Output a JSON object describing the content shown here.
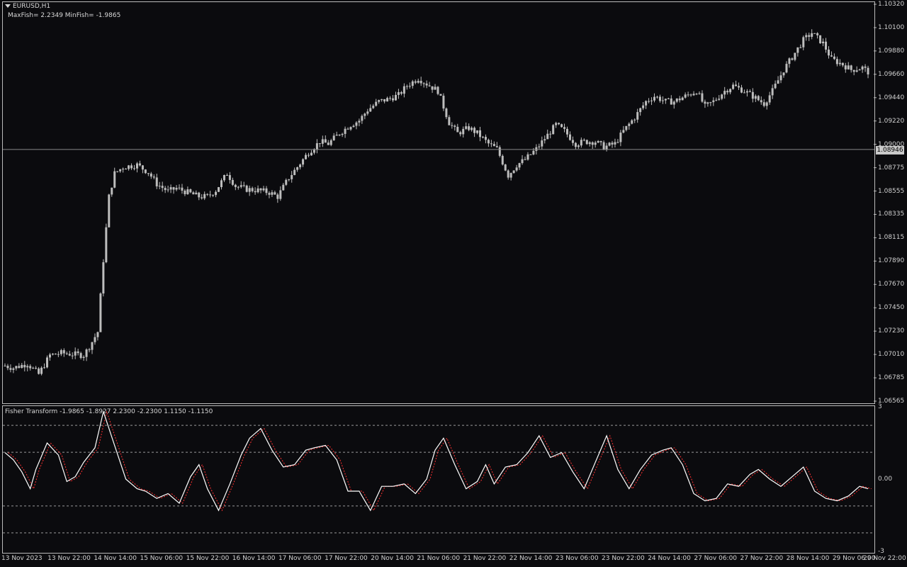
{
  "chart_header": {
    "symbol_label": "EURUSD,H1",
    "fisher_stats": "MaxFish= 2.2349 MinFish= -1.9865"
  },
  "indicator_header": {
    "label": "Fisher Transform -1.9865 -1.8927 2.2300 -2.2300 1.1150 -1.1150"
  },
  "colors": {
    "background": "#0b0b0e",
    "candle": "#bdbdbd",
    "fisher_line": "#ffffff",
    "signal_line": "#ff3030",
    "level_line": "#9a9a9a",
    "frame": "#bbbbbb"
  },
  "current_price": "1.08946",
  "price_axis": [
    "1.10320",
    "1.10100",
    "1.09880",
    "1.09660",
    "1.09440",
    "1.09220",
    "1.09000",
    "1.08775",
    "1.08555",
    "1.08335",
    "1.08115",
    "1.07890",
    "1.07670",
    "1.07450",
    "1.07230",
    "1.07010",
    "1.06785",
    "1.06565"
  ],
  "indicator_axis": [
    "3",
    "0.00",
    "-3"
  ],
  "time_axis": [
    "13 Nov 2023",
    "13 Nov 22:00",
    "14 Nov 14:00",
    "15 Nov 06:00",
    "15 Nov 22:00",
    "16 Nov 14:00",
    "17 Nov 06:00",
    "17 Nov 22:00",
    "20 Nov 14:00",
    "21 Nov 06:00",
    "21 Nov 22:00",
    "22 Nov 14:00",
    "23 Nov 06:00",
    "23 Nov 22:00",
    "24 Nov 14:00",
    "27 Nov 06:00",
    "27 Nov 22:00",
    "28 Nov 14:00",
    "29 Nov 06:00",
    "29 Nov 22:00"
  ],
  "chart_data": [
    {
      "type": "candlestick",
      "symbol": "EURUSD",
      "timeframe": "H1",
      "price_range": [
        1.06565,
        1.1032
      ],
      "trend_close": [
        [
          0,
          1.069
        ],
        [
          3,
          1.0688
        ],
        [
          8,
          1.0692
        ],
        [
          12,
          1.0682
        ],
        [
          16,
          1.07
        ],
        [
          20,
          1.0702
        ],
        [
          28,
          1.07
        ],
        [
          30,
          1.0708
        ],
        [
          33,
          1.0722
        ],
        [
          35,
          1.079
        ],
        [
          37,
          1.085
        ],
        [
          39,
          1.0872
        ],
        [
          42,
          1.0878
        ],
        [
          47,
          1.088
        ],
        [
          51,
          1.0873
        ],
        [
          54,
          1.0862
        ],
        [
          58,
          1.0855
        ],
        [
          61,
          1.0858
        ],
        [
          65,
          1.0854
        ],
        [
          69,
          1.085
        ],
        [
          72,
          1.085
        ],
        [
          75,
          1.0856
        ],
        [
          79,
          1.0872
        ],
        [
          82,
          1.086
        ],
        [
          86,
          1.0857
        ],
        [
          90,
          1.0856
        ],
        [
          94,
          1.0854
        ],
        [
          97,
          1.085
        ],
        [
          101,
          1.0868
        ],
        [
          104,
          1.0878
        ],
        [
          108,
          1.0892
        ],
        [
          112,
          1.0902
        ],
        [
          115,
          1.09
        ],
        [
          119,
          1.091
        ],
        [
          123,
          1.0918
        ],
        [
          126,
          1.0922
        ],
        [
          129,
          1.0932
        ],
        [
          133,
          1.094
        ],
        [
          136,
          1.0942
        ],
        [
          140,
          1.0946
        ],
        [
          143,
          1.0955
        ],
        [
          147,
          1.0962
        ],
        [
          151,
          1.0955
        ],
        [
          154,
          1.095
        ],
        [
          158,
          1.092
        ],
        [
          161,
          1.091
        ],
        [
          165,
          1.0915
        ],
        [
          168,
          1.091
        ],
        [
          172,
          1.09
        ],
        [
          175,
          1.0895
        ],
        [
          179,
          1.087
        ],
        [
          182,
          1.088
        ],
        [
          185,
          1.0885
        ],
        [
          189,
          1.0895
        ],
        [
          192,
          1.0905
        ],
        [
          196,
          1.0918
        ],
        [
          199,
          1.0912
        ],
        [
          203,
          1.09
        ],
        [
          206,
          1.0902
        ],
        [
          210,
          1.0902
        ],
        [
          213,
          1.0897
        ],
        [
          217,
          1.09
        ],
        [
          220,
          1.0912
        ],
        [
          224,
          1.0925
        ],
        [
          228,
          1.094
        ],
        [
          231,
          1.0945
        ],
        [
          235,
          1.094
        ],
        [
          238,
          1.094
        ],
        [
          242,
          1.0945
        ],
        [
          246,
          1.095
        ],
        [
          249,
          1.0935
        ],
        [
          252,
          1.094
        ],
        [
          256,
          1.095
        ],
        [
          259,
          1.0955
        ],
        [
          263,
          1.095
        ],
        [
          266,
          1.0945
        ],
        [
          270,
          1.0938
        ],
        [
          273,
          1.095
        ],
        [
          277,
          1.097
        ],
        [
          280,
          1.0982
        ],
        [
          284,
          1.0998
        ],
        [
          287,
          1.1005
        ],
        [
          291,
          1.0995
        ],
        [
          294,
          1.098
        ],
        [
          298,
          1.0975
        ],
        [
          301,
          1.097
        ],
        [
          305,
          1.0972
        ],
        [
          307,
          1.0968
        ]
      ]
    },
    {
      "type": "line",
      "name": "Fisher Transform",
      "y_range": [
        -3,
        3
      ],
      "levels": [
        2.23,
        1.115,
        -1.115,
        -2.23
      ],
      "x": [
        0,
        3,
        6,
        9,
        11,
        15,
        19,
        22,
        25,
        28,
        32,
        35,
        39,
        43,
        47,
        50,
        54,
        58,
        62,
        66,
        69,
        72,
        76,
        80,
        84,
        87,
        91,
        95,
        99,
        103,
        107,
        110,
        114,
        118,
        122,
        126,
        130,
        134,
        138,
        142,
        146,
        150,
        153,
        156,
        160,
        164,
        168,
        171,
        174,
        178,
        182,
        186,
        190,
        194,
        198,
        202,
        206,
        210,
        214,
        218,
        222,
        226,
        230,
        234,
        237,
        241,
        245,
        249,
        253,
        257,
        261,
        265,
        268,
        272,
        276,
        280,
        284,
        288,
        292,
        296,
        300,
        304,
        307
      ],
      "values": [
        1.1,
        0.8,
        0.3,
        -0.4,
        0.4,
        1.5,
        1.0,
        -0.1,
        0.1,
        0.7,
        1.3,
        2.8,
        1.4,
        0.0,
        -0.4,
        -0.5,
        -0.8,
        -0.6,
        -1.0,
        0.1,
        0.6,
        -0.4,
        -1.3,
        -0.2,
        1.0,
        1.7,
        2.1,
        1.2,
        0.5,
        0.6,
        1.2,
        1.3,
        1.4,
        0.8,
        -0.5,
        -0.5,
        -1.3,
        -0.3,
        -0.3,
        -0.2,
        -0.6,
        0.0,
        1.2,
        1.7,
        0.6,
        -0.4,
        -0.1,
        0.6,
        -0.2,
        0.5,
        0.6,
        1.1,
        1.8,
        0.9,
        1.1,
        0.3,
        -0.4,
        0.7,
        1.8,
        0.4,
        -0.4,
        0.4,
        1.0,
        1.2,
        1.3,
        0.6,
        -0.6,
        -0.9,
        -0.8,
        -0.2,
        -0.3,
        0.2,
        0.4,
        0.0,
        -0.3,
        0.1,
        0.5,
        -0.5,
        -0.8,
        -0.9,
        -0.7,
        -0.3,
        -0.4
      ]
    }
  ]
}
